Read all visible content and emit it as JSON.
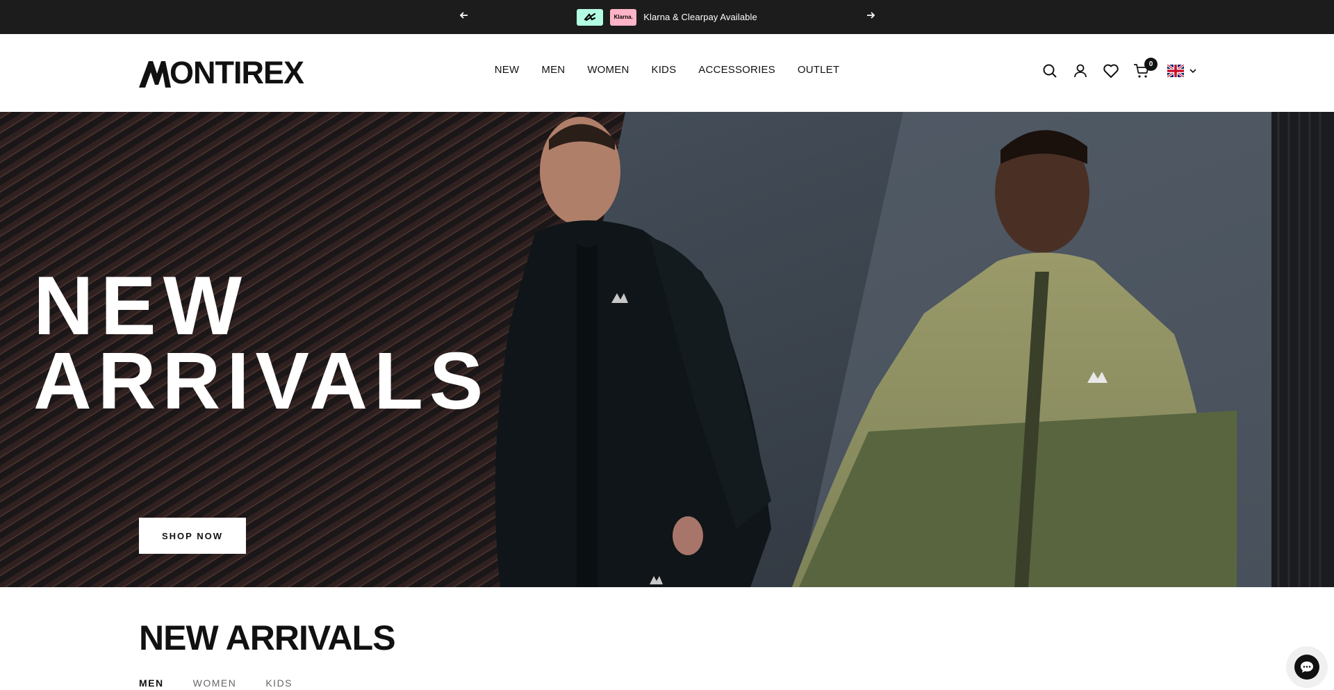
{
  "announcement": {
    "prev_icon": "arrow-left-icon",
    "next_icon": "arrow-right-icon",
    "badges": [
      "clearpay",
      "Klarna."
    ],
    "text": "Klarna & Clearpay Available"
  },
  "header": {
    "logo_text": "ONTIREX",
    "nav": [
      "NEW",
      "MEN",
      "WOMEN",
      "KIDS",
      "ACCESSORIES",
      "OUTLET"
    ],
    "icons": [
      "search-icon",
      "account-icon",
      "wishlist-heart-icon",
      "cart-icon",
      "uk-flag-icon",
      "chevron-down-icon"
    ],
    "cart_count": "0"
  },
  "hero": {
    "title_line1": "NEW",
    "title_line2": "ARRIVALS",
    "cta": "SHOP NOW"
  },
  "section": {
    "title": "NEW ARRIVALS",
    "tabs": [
      "MEN",
      "WOMEN",
      "KIDS"
    ]
  },
  "chat": {
    "icon": "chat-bubble-icon"
  },
  "colors": {
    "announcement_bg": "#1c1c1c",
    "clearpay_badge": "#b2fce4",
    "klarna_badge": "#ffb3c7",
    "text_dark": "#111111",
    "white": "#ffffff"
  }
}
